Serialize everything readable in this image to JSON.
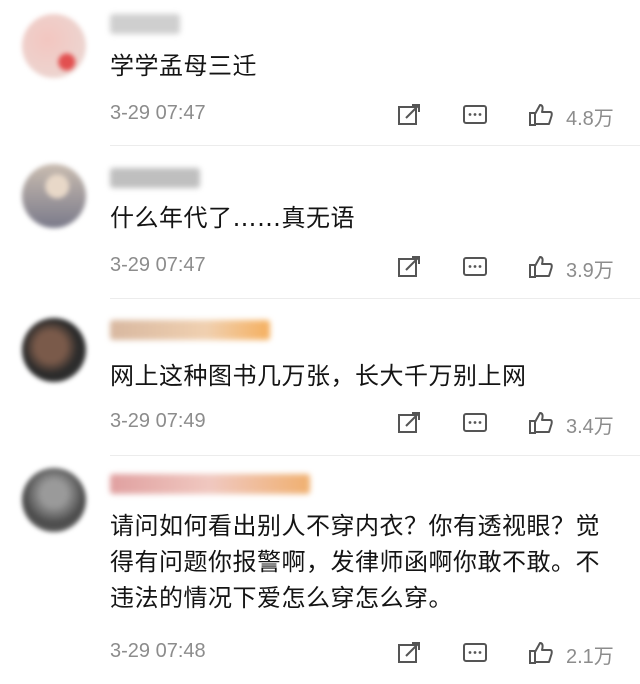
{
  "comments": [
    {
      "text": "学学孟母三迁",
      "time": "3-29 07:47",
      "likes": "4.8万"
    },
    {
      "text": "什么年代了……真无语",
      "time": "3-29 07:47",
      "likes": "3.9万"
    },
    {
      "text": "网上这种图书几万张，长大千万别上网",
      "time": "3-29 07:49",
      "likes": "3.4万"
    },
    {
      "text": "请问如何看出别人不穿内衣？你有透视眼？觉得有问题你报警啊，发律师函啊你敢不敢。不违法的情况下爱怎么穿怎么穿。",
      "time": "3-29 07:48",
      "likes": "2.1万"
    }
  ],
  "icons": {
    "repost": "repost-icon",
    "comment": "comment-icon",
    "like": "thumbs-up-icon"
  },
  "colors": {
    "meta_text": "#8c8c8c",
    "icon_stroke": "#555555"
  }
}
